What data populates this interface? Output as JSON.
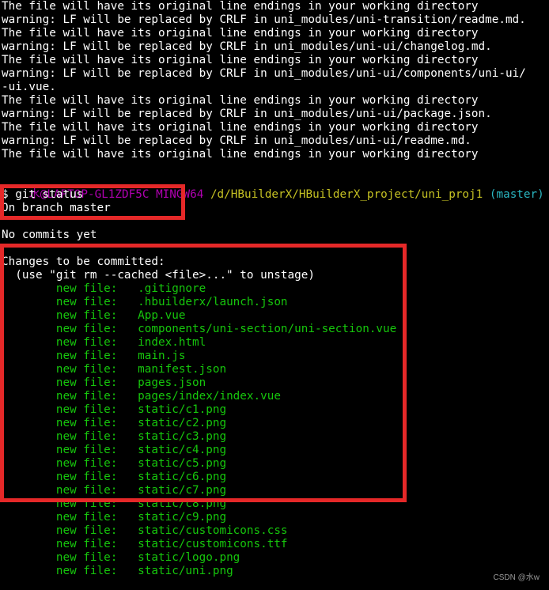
{
  "terminal": {
    "header_lines": [
      "The file will have its original line endings in your working directory",
      "warning: LF will be replaced by CRLF in uni_modules/uni-transition/readme.md.",
      "The file will have its original line endings in your working directory",
      "warning: LF will be replaced by CRLF in uni_modules/uni-ui/changelog.md.",
      "The file will have its original line endings in your working directory",
      "warning: LF will be replaced by CRLF in uni_modules/uni-ui/components/uni-ui/",
      "-ui.vue.",
      "The file will have its original line endings in your working directory",
      "warning: LF will be replaced by CRLF in uni_modules/uni-ui/package.json.",
      "The file will have its original line endings in your working directory",
      "warning: LF will be replaced by CRLF in uni_modules/uni-ui/readme.md.",
      "The file will have its original line endings in your working directory"
    ],
    "prompt": {
      "user": "水@LAPTOP-GL1ZDF5C",
      "shell": "MINGW64",
      "path": "/d/HBuilderX/HBuilderX_project/uni_proj1",
      "branch": "(master)"
    },
    "command": "$ git status",
    "branch_line": "On branch master",
    "no_commits": "No commits yet",
    "changes_header": "Changes to be committed:",
    "unstage_hint": "  (use \"git rm --cached <file>...\" to unstage)",
    "new_file_label": "new file:",
    "files": [
      ".gitignore",
      ".hbuilderx/launch.json",
      "App.vue",
      "components/uni-section/uni-section.vue",
      "index.html",
      "main.js",
      "manifest.json",
      "pages.json",
      "pages/index/index.vue",
      "static/c1.png",
      "static/c2.png",
      "static/c3.png",
      "static/c4.png",
      "static/c5.png",
      "static/c6.png",
      "static/c7.png",
      "static/c8.png",
      "static/c9.png",
      "static/customicons.css",
      "static/customicons.ttf",
      "static/logo.png",
      "static/uni.png"
    ],
    "highlight_color": "#e52828"
  },
  "watermark": "CSDN @水w"
}
